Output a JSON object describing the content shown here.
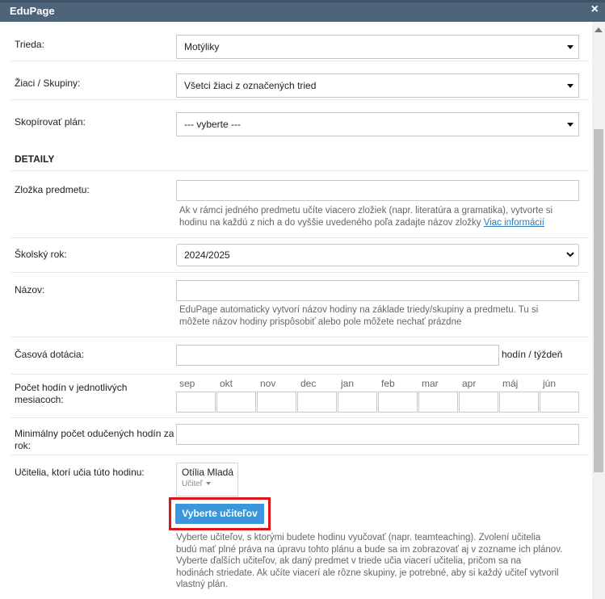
{
  "window": {
    "title": "EduPage",
    "close_icon": "×"
  },
  "form": {
    "trieda": {
      "label": "Trieda:",
      "value": "Motýliky"
    },
    "ziaci": {
      "label": "Žiaci / Skupiny:",
      "value": "Všetci žiaci z označených tried"
    },
    "kopirovat": {
      "label": "Skopírovať plán:",
      "value": "--- vyberte ---"
    },
    "section_details": "DETAILY",
    "zlozka": {
      "label": "Zložka predmetu:",
      "value": "",
      "hint_line1": "Ak v rámci jedného predmetu učíte viacero zložiek (napr. literatúra a gramatika), vytvorte si",
      "hint_line2": "hodinu na každú z nich a do vyššie uvedeného poľa zadajte názov zložky",
      "hint_link": "Viac informácií"
    },
    "skolsky_rok": {
      "label": "Školský rok:",
      "value": "2024/2025"
    },
    "nazov": {
      "label": "Názov:",
      "value": "",
      "hint_line1": "EduPage automaticky vytvorí názov hodiny na základe triedy/skupiny a predmetu. Tu si",
      "hint_line2": "môžete názov hodiny prispôsobiť alebo pole môžete nechať prázdne"
    },
    "dotacia": {
      "label": "Časová dotácia:",
      "value": "",
      "unit": "hodín / týždeň"
    },
    "pocet_hodin": {
      "label_line1": "Počet hodín v jednotlivých",
      "label_line2": "mesiacoch:",
      "months": [
        "sep",
        "okt",
        "nov",
        "dec",
        "jan",
        "feb",
        "mar",
        "apr",
        "máj",
        "jún"
      ]
    },
    "min_pocet": {
      "label_line1": "Minimálny počet odučených hodín za",
      "label_line2": "rok:",
      "value": ""
    },
    "ucitelia": {
      "label": "Učitelia, ktorí učia túto hodinu:",
      "teacher_name": "Otília Mladá",
      "teacher_role": "Učiteľ",
      "button": "Vyberte učiteľov",
      "hint_lines": [
        "Vyberte učiteľov, s ktorými budete hodinu vyučovať (napr. teamteaching). Zvolení učitelia",
        "budú mať plné práva na úpravu tohto plánu a bude sa im zobrazovať aj v zozname ich plánov.",
        "Vyberte ďalších učiteľov, ak daný predmet v triede učia viacerí učitelia, pričom sa na",
        "hodinách striedate. Ak učíte viacerí ale rôzne skupiny, je potrebné, aby si každý učiteľ vytvoril",
        "vlastný plán."
      ]
    }
  },
  "colors": {
    "titlebar": "#4e6479",
    "button": "#3a97db",
    "highlight": "#e01414",
    "link": "#2a7bc0"
  }
}
